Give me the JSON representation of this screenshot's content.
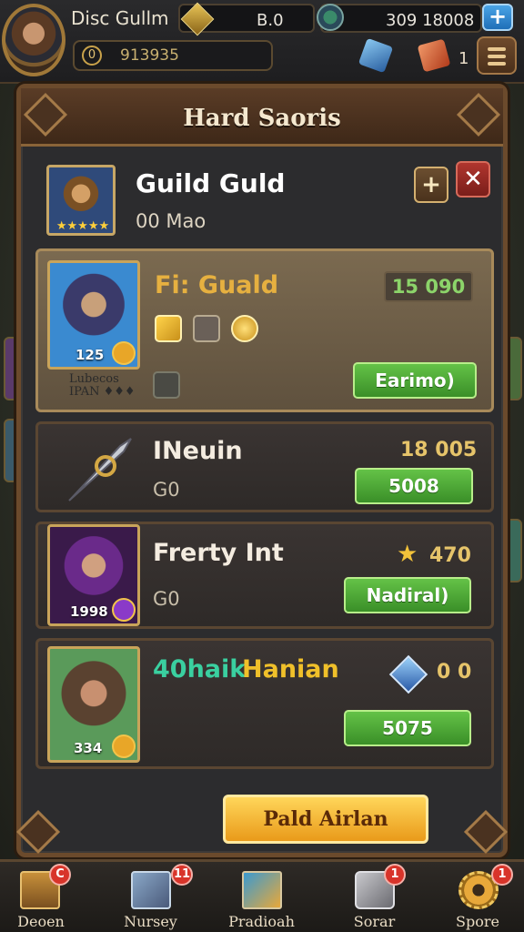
{
  "hud": {
    "player_name": "Disc Gullm",
    "gem_value": "B.0",
    "coin_value": "309 18008",
    "plus_label": "+",
    "level_number": "0",
    "level_value": "913935",
    "side_count": "1"
  },
  "panel": {
    "title": "Hard Saoris"
  },
  "guild": {
    "name": "Guild Guld",
    "subtitle": "00 Mao",
    "stars": "★★★★★",
    "add_label": "+",
    "close_label": "✕"
  },
  "list": [
    {
      "name": "Fi: Guald",
      "name_color": "#e6b040",
      "stat": "15 090",
      "stat_color_a": "#e8d090",
      "portrait_level": "125",
      "caption": "Lubecos\nIPAN ♦♦♦",
      "button": "Earimo)",
      "selected": true
    },
    {
      "name": "INeuin",
      "name_color": "#f4ece0",
      "stat": "18 005",
      "sub": "G0",
      "button": "5008"
    },
    {
      "name": "Frerty Int",
      "name_color": "#f4ece0",
      "stat": "470",
      "sub": "G0",
      "portrait_level": "1998",
      "button": "Nadiral)"
    },
    {
      "name_part1": "40haik",
      "name_part2": "Hanian",
      "stat": "0 0",
      "portrait_level": "334",
      "button": "5075"
    }
  ],
  "action_button": "Pald Airlan",
  "bottom_nav": [
    {
      "label": "Deoen",
      "badge": "C",
      "icon": "chest-icon"
    },
    {
      "label": "Nursey",
      "badge": "11",
      "icon": "cube-icon"
    },
    {
      "label": "Pradioah",
      "badge": "",
      "icon": "book-icon"
    },
    {
      "label": "Sorar",
      "badge": "1",
      "icon": "stone-icon"
    },
    {
      "label": "Spore",
      "badge": "1",
      "icon": "gear-icon"
    }
  ],
  "colors": {
    "accent_gold": "#e6b040",
    "button_green": "#64c247",
    "close_red": "#b0352e",
    "currency_blue": "#4aa4e6"
  }
}
